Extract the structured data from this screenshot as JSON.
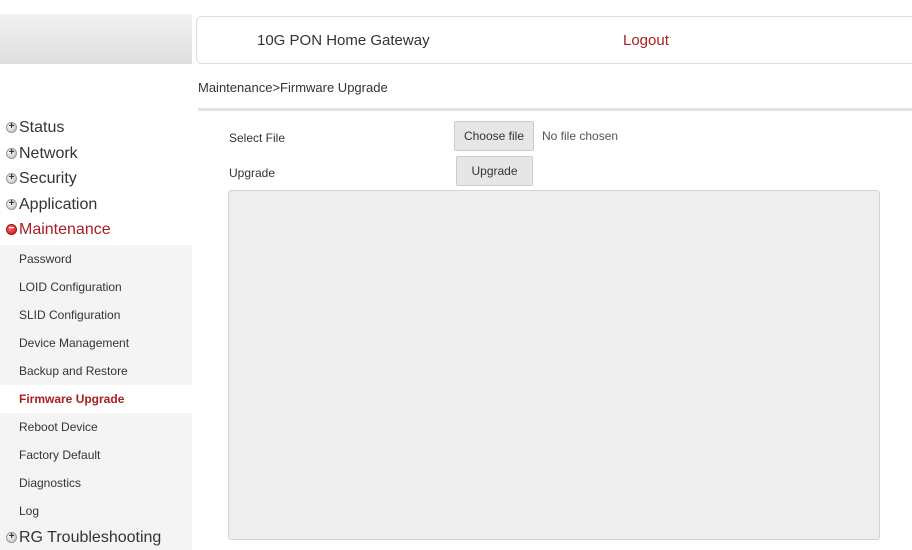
{
  "header": {
    "title": "10G PON Home Gateway",
    "logout": "Logout"
  },
  "breadcrumb": "Maintenance>Firmware Upgrade",
  "sidebar": {
    "menu": [
      {
        "label": "Status",
        "state": "collapsed"
      },
      {
        "label": "Network",
        "state": "collapsed"
      },
      {
        "label": "Security",
        "state": "collapsed"
      },
      {
        "label": "Application",
        "state": "collapsed"
      },
      {
        "label": "Maintenance",
        "state": "expanded"
      }
    ],
    "maintenance_items": [
      {
        "label": "Password"
      },
      {
        "label": "LOID Configuration"
      },
      {
        "label": "SLID Configuration"
      },
      {
        "label": "Device Management"
      },
      {
        "label": "Backup and Restore"
      },
      {
        "label": "Firmware Upgrade",
        "active": true
      },
      {
        "label": "Reboot Device"
      },
      {
        "label": "Factory Default"
      },
      {
        "label": "Diagnostics"
      },
      {
        "label": "Log"
      }
    ],
    "last_menu": {
      "label": "RG Troubleshooting",
      "state": "collapsed"
    }
  },
  "form": {
    "select_file_label": "Select File",
    "choose_file_button": "Choose file",
    "no_file_text": "No file chosen",
    "upgrade_label": "Upgrade",
    "upgrade_button": "Upgrade",
    "output_text": ""
  },
  "colors": {
    "accent": "#a81e21",
    "submenu_background": "#f4f4f4",
    "button_background": "#e6e6e6"
  }
}
